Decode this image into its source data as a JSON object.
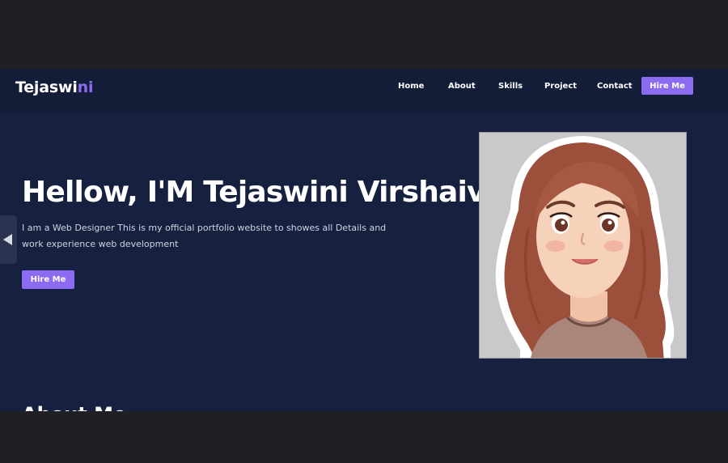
{
  "logo": {
    "text_main": "Tejaswi",
    "text_accent": "ni"
  },
  "nav": {
    "items": [
      {
        "label": "Home"
      },
      {
        "label": "About"
      },
      {
        "label": "Skills"
      },
      {
        "label": "Project"
      },
      {
        "label": "Contact"
      }
    ],
    "cta_label": "Hire Me"
  },
  "hero": {
    "title": "Hellow, I'M Tejaswini Virshaiv",
    "description": "I am a Web Designer This is my official portfolio website to showes all Details and work experience web development",
    "cta_label": "Hire Me"
  },
  "next_section": {
    "heading": "About Me"
  },
  "colors": {
    "accent": "#8b6cf0",
    "background": "#16213f",
    "navbar": "#141d38",
    "frame": "#1f2023"
  },
  "icons": {
    "side_tab": "left-arrow-icon"
  }
}
